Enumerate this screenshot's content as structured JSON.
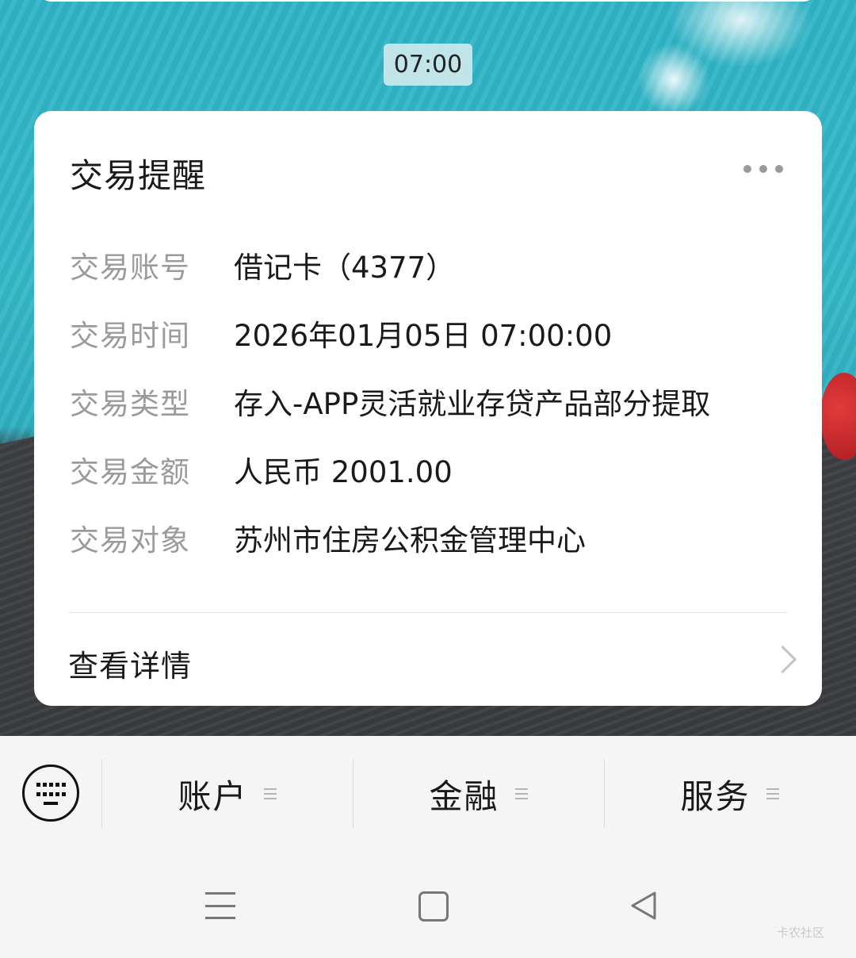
{
  "chat": {
    "timestamp": "07:00"
  },
  "card": {
    "title": "交易提醒",
    "more_icon": "more-dots-icon",
    "rows": [
      {
        "label": "交易账号",
        "value": "借记卡（4377）"
      },
      {
        "label": "交易时间",
        "value": "2026年01月05日 07:00:00"
      },
      {
        "label": "交易类型",
        "value": "存入-APP灵活就业存贷产品部分提取"
      },
      {
        "label": "交易金额",
        "value": "人民币 2001.00"
      },
      {
        "label": "交易对象",
        "value": "苏州市住房公积金管理中心"
      }
    ],
    "details_label": "查看详情",
    "details_icon": "chevron-right-icon"
  },
  "menu": {
    "keyboard_icon": "keyboard-icon",
    "items": [
      {
        "label": "账户"
      },
      {
        "label": "金融"
      },
      {
        "label": "服务"
      }
    ]
  },
  "nav": {
    "menu_icon": "hamburger-icon",
    "home_icon": "square-home-icon",
    "back_icon": "triangle-back-icon"
  },
  "watermark": "卡农社区",
  "colors": {
    "wallpaper_teal": "#2fb4c6",
    "wallpaper_dark": "#3c3e41",
    "card_bg": "#ffffff",
    "label_gray": "#9b9b9b",
    "text_dark": "#1a1a1a",
    "menu_bg": "#f5f5f5"
  }
}
